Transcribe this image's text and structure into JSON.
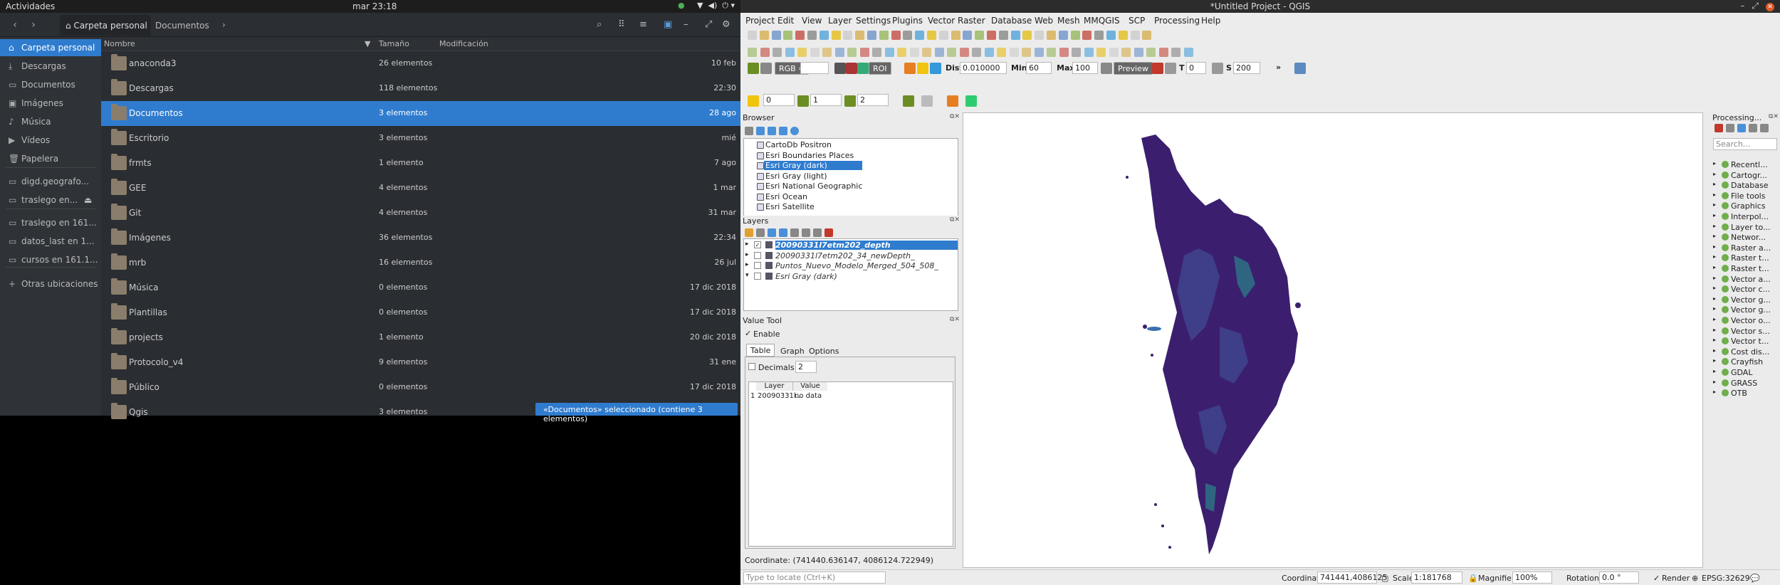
{
  "topbar": {
    "activities": "Actividades",
    "clock": "mar 23:18"
  },
  "nautilus": {
    "tabs": [
      {
        "label": "Carpeta personal"
      },
      {
        "label": "Documentos"
      }
    ],
    "sidebar": [
      {
        "label": "Carpeta personal",
        "icon": "home-icon"
      },
      {
        "label": "Descargas",
        "icon": "download-icon"
      },
      {
        "label": "Documentos",
        "icon": "document-icon"
      },
      {
        "label": "Imágenes",
        "icon": "image-icon"
      },
      {
        "label": "Música",
        "icon": "music-icon"
      },
      {
        "label": "Vídeos",
        "icon": "video-icon"
      },
      {
        "label": "Papelera",
        "icon": "trash-icon"
      },
      {
        "label": "digd.geografo...",
        "icon": "network-icon"
      },
      {
        "label": "traslego en...",
        "icon": "drive-icon"
      },
      {
        "label": "traslego en 161...",
        "icon": "network-icon"
      },
      {
        "label": "datos_last en 1...",
        "icon": "network-icon"
      },
      {
        "label": "cursos en 161.1...",
        "icon": "network-icon"
      },
      {
        "label": "Otras ubicaciones",
        "icon": "plus-icon"
      }
    ],
    "columns": {
      "name": "Nombre",
      "size": "Tamaño",
      "modified": "Modificación"
    },
    "rows": [
      {
        "name": "anaconda3",
        "size": "26 elementos",
        "date": "10 feb"
      },
      {
        "name": "Descargas",
        "size": "118 elementos",
        "date": "22:30"
      },
      {
        "name": "Documentos",
        "size": "3 elementos",
        "date": "28 ago"
      },
      {
        "name": "Escritorio",
        "size": "3 elementos",
        "date": "mié"
      },
      {
        "name": "frmts",
        "size": "1 elemento",
        "date": "7 ago"
      },
      {
        "name": "GEE",
        "size": "4 elementos",
        "date": "1 mar"
      },
      {
        "name": "Git",
        "size": "4 elementos",
        "date": "31 mar"
      },
      {
        "name": "Imágenes",
        "size": "36 elementos",
        "date": "22:34"
      },
      {
        "name": "mrb",
        "size": "16 elementos",
        "date": "26 jul"
      },
      {
        "name": "Música",
        "size": "0 elementos",
        "date": "17 dic 2018"
      },
      {
        "name": "Plantillas",
        "size": "0 elementos",
        "date": "17 dic 2018"
      },
      {
        "name": "projects",
        "size": "1 elemento",
        "date": "20 dic 2018"
      },
      {
        "name": "Protocolo_v4",
        "size": "9 elementos",
        "date": "31 ene"
      },
      {
        "name": "Público",
        "size": "0 elementos",
        "date": "17 dic 2018"
      },
      {
        "name": "Qgis",
        "size": "3 elementos",
        "date": ""
      }
    ],
    "status": "«Documentos» seleccionado  (contiene 3 elementos)"
  },
  "qgis": {
    "title": "*Untitled Project - QGIS",
    "menu": [
      "Project",
      "Edit",
      "View",
      "Layer",
      "Settings",
      "Plugins",
      "Vector",
      "Raster",
      "Database",
      "Web",
      "Mesh",
      "MMQGIS",
      "SCP",
      "Processing",
      "Help"
    ],
    "scp": {
      "rgb": "RGB =",
      "roi": "ROI",
      "dist_label": "Dist",
      "dist": "0.010000",
      "min_label": "Min",
      "min": "60",
      "max_label": "Max",
      "max": "100",
      "preview": "Preview",
      "t_label": "T",
      "t": "0",
      "s_label": "S",
      "s": "200"
    },
    "spin": {
      "a": "0",
      "b": "1",
      "c": "2"
    },
    "browser": {
      "title": "Browser",
      "items": [
        "CartoDb Positron",
        "Esri Boundaries Places",
        "Esri Gray (dark)",
        "Esri Gray (light)",
        "Esri National Geographic",
        "Esri Ocean",
        "Esri Satellite"
      ]
    },
    "layers": {
      "title": "Layers",
      "items": [
        "20090331l7etm202_depth",
        "20090331l7etm202_34_newDepth_",
        "Puntos_Nuevo_Modelo_Merged_504_508_",
        "Esri Gray (dark)"
      ]
    },
    "valuetool": {
      "title": "Value Tool",
      "enable": "Enable",
      "tabs": [
        "Table",
        "Graph",
        "Options"
      ],
      "decimals_label": "Decimals",
      "decimals": "2",
      "col_layer": "Layer",
      "col_value": "Value",
      "row_idx": "1",
      "row_layer": "20090331l...",
      "row_value": "no data"
    },
    "coordinate": "Coordinate: (741440.636147, 4086124.722949)",
    "processing": {
      "title": "Processing...",
      "search": "Search...",
      "items": [
        "Recentl...",
        "Cartogr...",
        "Database",
        "File tools",
        "Graphics",
        "Interpol...",
        "Layer to...",
        "Networ...",
        "Raster a...",
        "Raster t...",
        "Raster t...",
        "Vector a...",
        "Vector c...",
        "Vector g...",
        "Vector g...",
        "Vector o...",
        "Vector s...",
        "Vector t...",
        "Cost dis...",
        "Crayfish",
        "GDAL",
        "GRASS",
        "OTB"
      ]
    },
    "statusbar": {
      "locate": "Type to locate (Ctrl+K)",
      "coord_label": "Coordinate",
      "coord": "741441,4086125",
      "scale_label": "Scale",
      "scale": "1:181768",
      "magnifier_label": "Magnifier",
      "magnifier": "100%",
      "rotation_label": "Rotation",
      "rotation": "0.0 °",
      "render": "Render",
      "crs": "EPSG:32629"
    }
  }
}
